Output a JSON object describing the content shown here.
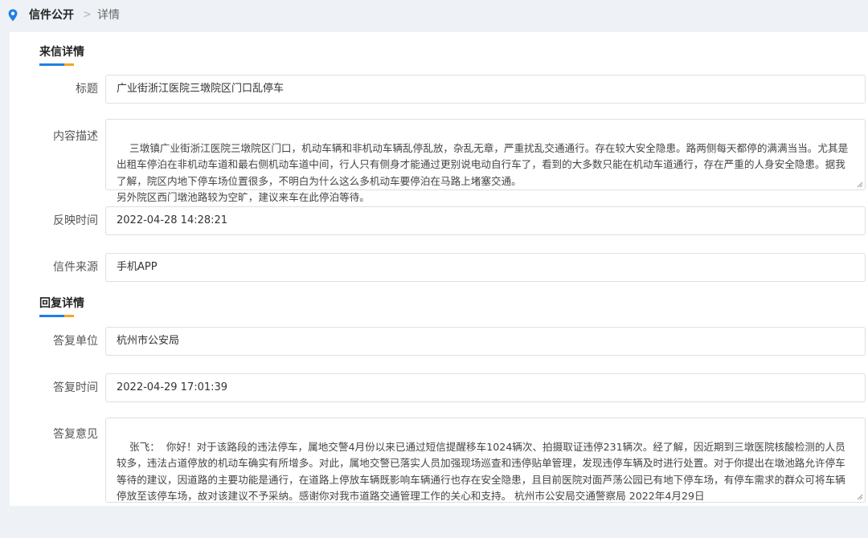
{
  "breadcrumb": {
    "home": "信件公开",
    "separator": ">",
    "current": "详情"
  },
  "letter_section": {
    "title": "来信详情",
    "fields": {
      "title_label": "标题",
      "title_value": "广业街浙江医院三墩院区门口乱停车",
      "content_label": "内容描述",
      "content_value": "三墩镇广业街浙江医院三墩院区门口，机动车辆和非机动车辆乱停乱放，杂乱无章，严重扰乱交通通行。存在较大安全隐患。路两侧每天都停的满满当当。尤其是出租车停泊在非机动车道和最右侧机动车道中间，行人只有侧身才能通过更别说电动自行车了，看到的大多数只能在机动车道通行，存在严重的人身安全隐患。据我了解，院区内地下停车场位置很多，不明白为什么这么多机动车要停泊在马路上堵塞交通。\n另外院区西门墩池路较为空旷，建议来车在此停泊等待。",
      "time_label": "反映时间",
      "time_value": "2022-04-28 14:28:21",
      "source_label": "信件来源",
      "source_value": "手机APP"
    }
  },
  "reply_section": {
    "title": "回复详情",
    "fields": {
      "unit_label": "答复单位",
      "unit_value": "杭州市公安局",
      "time_label": "答复时间",
      "time_value": "2022-04-29 17:01:39",
      "opinion_label": "答复意见",
      "opinion_value": "张飞：  你好！对于该路段的违法停车，属地交警4月份以来已通过短信提醒移车1024辆次、拍摄取证违停231辆次。经了解，因近期到三墩医院核酸检测的人员较多，违法占道停放的机动车确实有所增多。对此，属地交警已落实人员加强现场巡查和违停贴单管理，发现违停车辆及时进行处置。对于你提出在墩池路允许停车等待的建议，因道路的主要功能是通行，在道路上停放车辆既影响车辆通行也存在安全隐患，且目前医院对面芦荡公园已有地下停车场，有停车需求的群众可将车辆停放至该停车场，故对该建议不予采纳。感谢你对我市道路交通管理工作的关心和支持。 杭州市公安局交通警察局 2022年4月29日"
    }
  },
  "colors": {
    "accent_blue": "#1f7fe6",
    "accent_orange": "#f5a623",
    "page_bg": "#eef1f5"
  },
  "icons": {
    "breadcrumb_icon": "location-pin-icon",
    "textarea_handle": "resize-handle-icon"
  }
}
